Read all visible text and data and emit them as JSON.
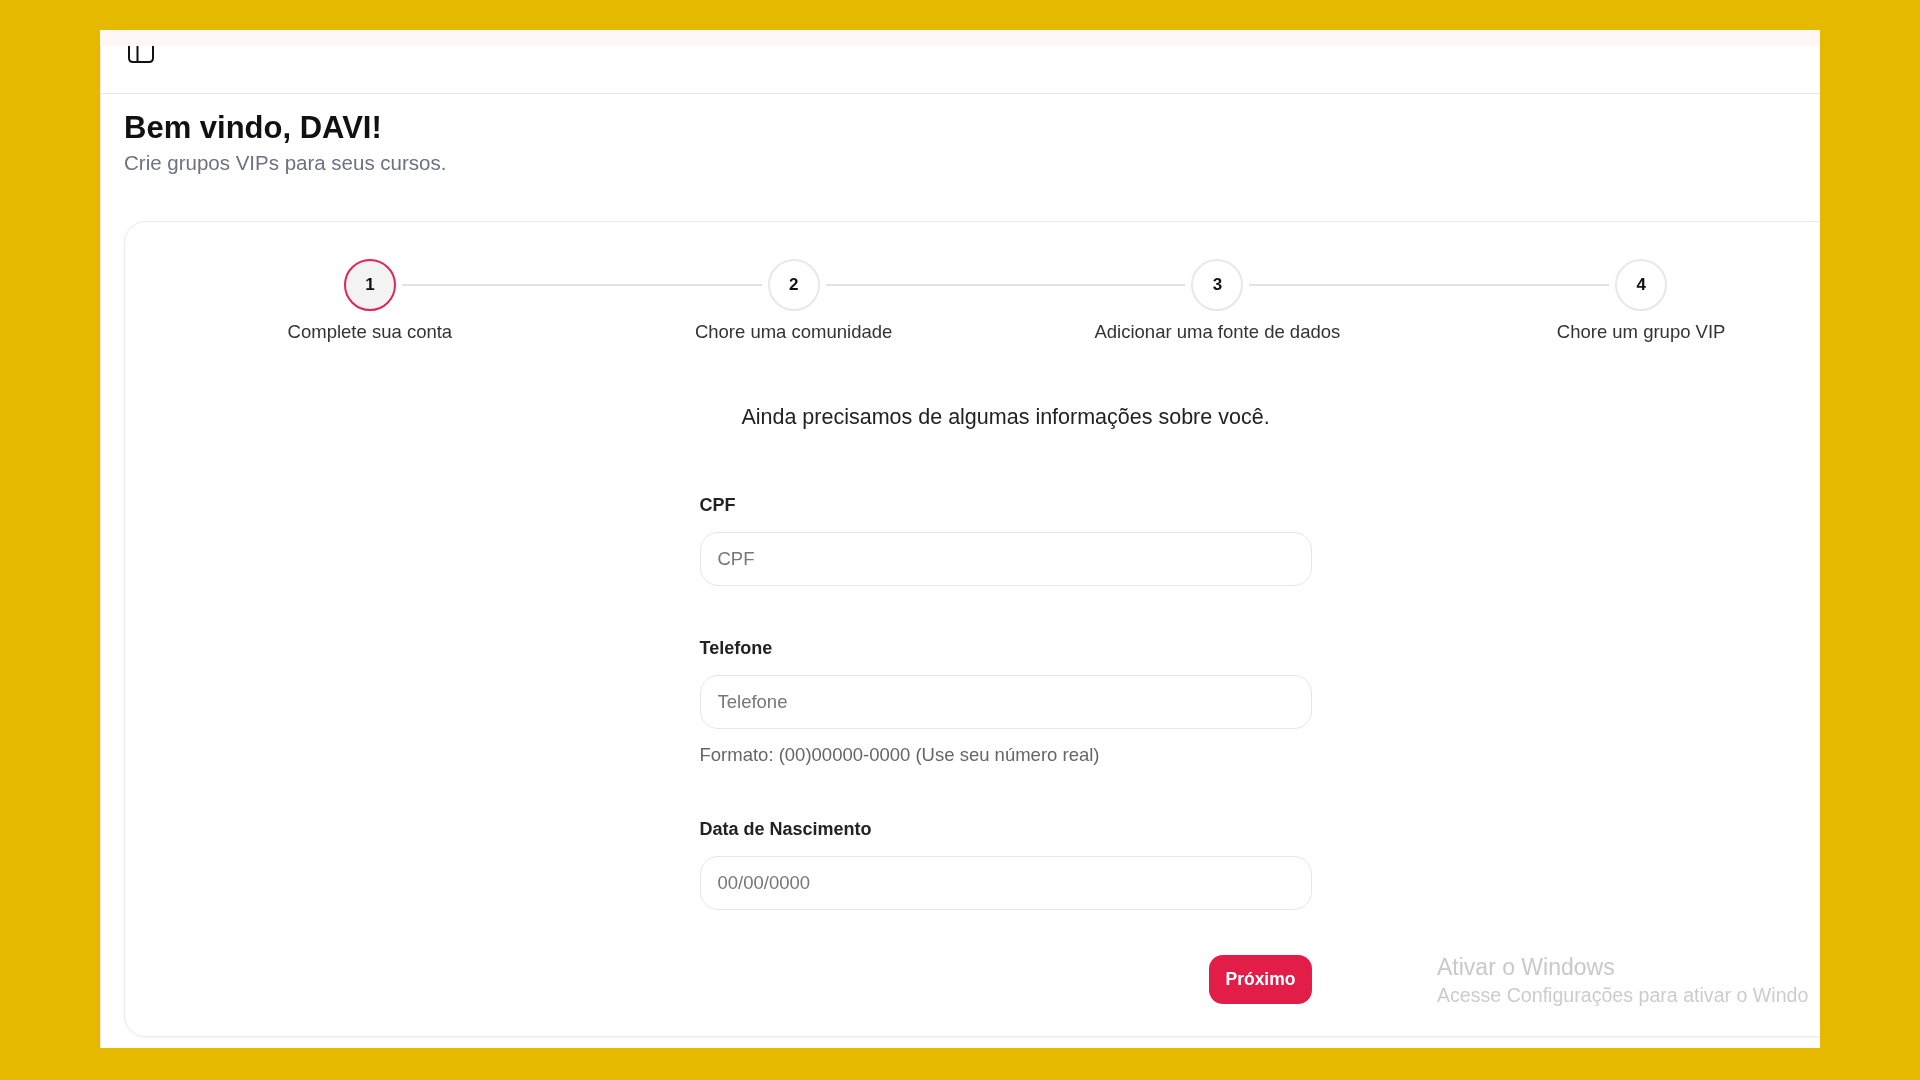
{
  "page": {
    "title": "Bem vindo, DAVI!",
    "subtitle": "Crie grupos VIPs para seus cursos."
  },
  "stepper": [
    {
      "number": "1",
      "label": "Complete sua conta",
      "selected": true
    },
    {
      "number": "2",
      "label": "Chore uma comunidade",
      "selected": false
    },
    {
      "number": "3",
      "label": "Adicionar uma fonte de dados",
      "selected": false
    },
    {
      "number": "4",
      "label": "Chore um grupo VIP",
      "selected": false
    }
  ],
  "form": {
    "intro": "Ainda precisamos de algumas informações sobre você.",
    "fields": [
      {
        "label": "CPF",
        "placeholder": "CPF"
      },
      {
        "label": "Telefone",
        "placeholder": "Telefone",
        "hint": "Formato: (00)00000-0000 (Use seu número real)"
      },
      {
        "label": "Data de Nascimento",
        "placeholder": "00/00/0000"
      }
    ],
    "submit": "Próximo"
  },
  "activation_notice": {
    "title": "Ativar o Windows",
    "message": "Acesse Configurações para ativar o Windo"
  }
}
